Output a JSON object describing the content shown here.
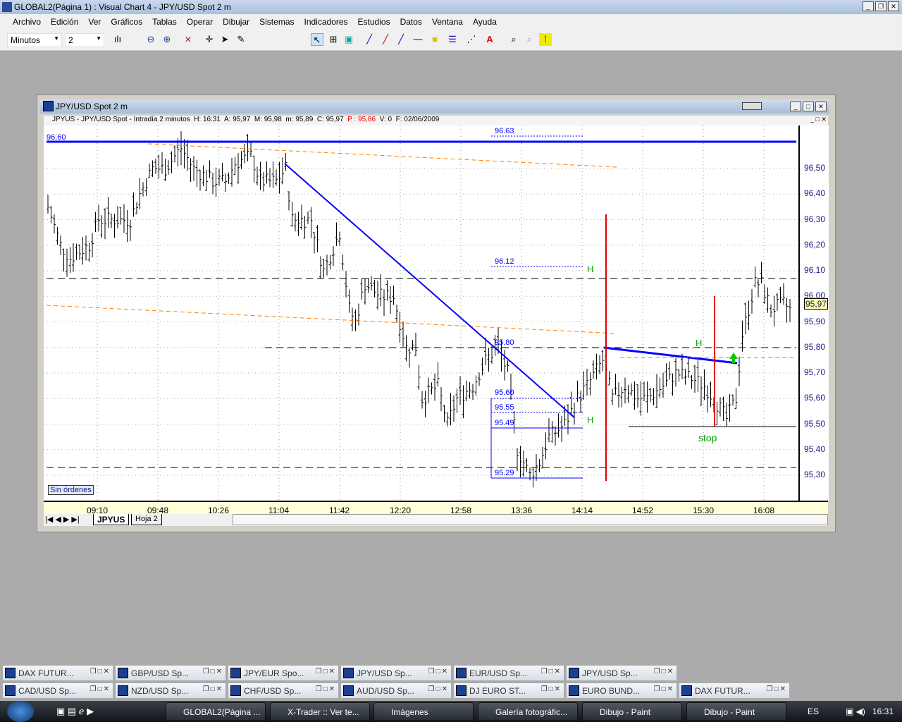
{
  "app": {
    "title": "GLOBAL2(Página 1) : Visual Chart 4 - JPY/USD Spot 2 m"
  },
  "menu": [
    "Archivo",
    "Edición",
    "Ver",
    "Gráficos",
    "Tablas",
    "Operar",
    "Dibujar",
    "Sistemas",
    "Indicadores",
    "Estudios",
    "Datos",
    "Ventana",
    "Ayuda"
  ],
  "toolbar": {
    "period_unit": "Minutos",
    "period_value": "2"
  },
  "chart_window": {
    "title": "JPY/USD Spot 2 m",
    "info": {
      "symbol": "JPYUS - JPY/USD Spot - Intradía 2 minutos",
      "h": "H: 16:31",
      "a": "A: 95,97",
      "m": "M: 95,98",
      "min": "m: 95,89",
      "c": "C: 95,97",
      "p": "P : 95,86",
      "v": "V: 0",
      "f": "F: 02/06/2009"
    },
    "orders_label": "Sin órdenes",
    "sheet_tabs": [
      "JPYUS",
      "Hoja 2"
    ],
    "current_price": "95,97"
  },
  "chart_data": {
    "type": "bar",
    "y_ticks": [
      "96,50",
      "96,40",
      "96,30",
      "96,20",
      "96,10",
      "96,00",
      "95,90",
      "95,80",
      "95,70",
      "95,60",
      "95,50",
      "95,40",
      "95,30"
    ],
    "y_tick_values": [
      96.5,
      96.4,
      96.3,
      96.2,
      96.1,
      96.0,
      95.9,
      95.8,
      95.7,
      95.6,
      95.5,
      95.4,
      95.3
    ],
    "x_ticks": [
      "09:10",
      "09:48",
      "10:26",
      "11:04",
      "11:42",
      "12:20",
      "12:58",
      "13:36",
      "14:14",
      "14:52",
      "15:30",
      "16:08"
    ],
    "price_path": [
      [
        0,
        96.35
      ],
      [
        4,
        96.2
      ],
      [
        7,
        96.15
      ],
      [
        13,
        96.2
      ],
      [
        16,
        96.3
      ],
      [
        20,
        96.3
      ],
      [
        26,
        96.3
      ],
      [
        29,
        96.4
      ],
      [
        33,
        96.5
      ],
      [
        37,
        96.5
      ],
      [
        42,
        96.58
      ],
      [
        46,
        96.5
      ],
      [
        52,
        96.45
      ],
      [
        56,
        96.45
      ],
      [
        59,
        96.52
      ],
      [
        64,
        96.55
      ],
      [
        67,
        96.45
      ],
      [
        72,
        96.45
      ],
      [
        75,
        96.5
      ],
      [
        77,
        96.3
      ],
      [
        83,
        96.3
      ],
      [
        87,
        96.1
      ],
      [
        92,
        96.25
      ],
      [
        95,
        95.95
      ],
      [
        97,
        95.9
      ],
      [
        100,
        96.05
      ],
      [
        105,
        96.0
      ],
      [
        109,
        96.0
      ],
      [
        113,
        95.8
      ],
      [
        116,
        95.8
      ],
      [
        118,
        95.6
      ],
      [
        123,
        95.65
      ],
      [
        126,
        95.5
      ],
      [
        129,
        95.6
      ],
      [
        134,
        95.65
      ],
      [
        138,
        95.75
      ],
      [
        142,
        95.8
      ],
      [
        145,
        95.7
      ],
      [
        148,
        95.4
      ],
      [
        152,
        95.3
      ],
      [
        155,
        95.35
      ],
      [
        158,
        95.45
      ],
      [
        163,
        95.5
      ],
      [
        167,
        95.6
      ],
      [
        170,
        95.65
      ],
      [
        175,
        95.75
      ],
      [
        178,
        95.6
      ],
      [
        182,
        95.65
      ],
      [
        186,
        95.6
      ],
      [
        189,
        95.6
      ],
      [
        194,
        95.65
      ],
      [
        198,
        95.7
      ],
      [
        203,
        95.68
      ],
      [
        207,
        95.65
      ],
      [
        210,
        95.6
      ],
      [
        214,
        95.52
      ],
      [
        217,
        95.6
      ],
      [
        219,
        95.85
      ],
      [
        223,
        96.05
      ],
      [
        225,
        96.05
      ],
      [
        228,
        95.95
      ],
      [
        232,
        95.97
      ],
      [
        234,
        95.95
      ]
    ],
    "annotations": {
      "level_9660": "96.60",
      "level_9663": "96.63",
      "level_9612": "96.12",
      "level_9580": "95.80",
      "level_9560": "95.60",
      "level_9555": "95.55",
      "level_9549": "95.49",
      "level_9529": "95.29",
      "h1": "H",
      "h2": "H",
      "h3": "H",
      "stop": "stop"
    }
  },
  "minimized": [
    [
      "DAX FUTUR...",
      "GBP/USD Sp...",
      "JPY/EUR Spo...",
      "JPY/USD Sp...",
      "EUR/USD Sp...",
      "JPY/USD Sp..."
    ],
    [
      "CAD/USD Sp...",
      "NZD/USD Sp...",
      "CHF/USD Sp...",
      "AUD/USD Sp...",
      "DJ EURO ST...",
      "EURO BUND...",
      "DAX FUTUR..."
    ]
  ],
  "taskbar": {
    "tasks": [
      "GLOBAL2(Página ...",
      "X-Trader :: Ver te...",
      "Imágenes",
      "Galería fotográfic...",
      "Dibujo - Paint",
      "Dibujo - Paint"
    ],
    "lang": "ES",
    "clock": "16:31"
  },
  "colors": {
    "trend": "#0000ff",
    "red": "#e00000",
    "green": "#00a000",
    "orange": "#ff8000"
  }
}
